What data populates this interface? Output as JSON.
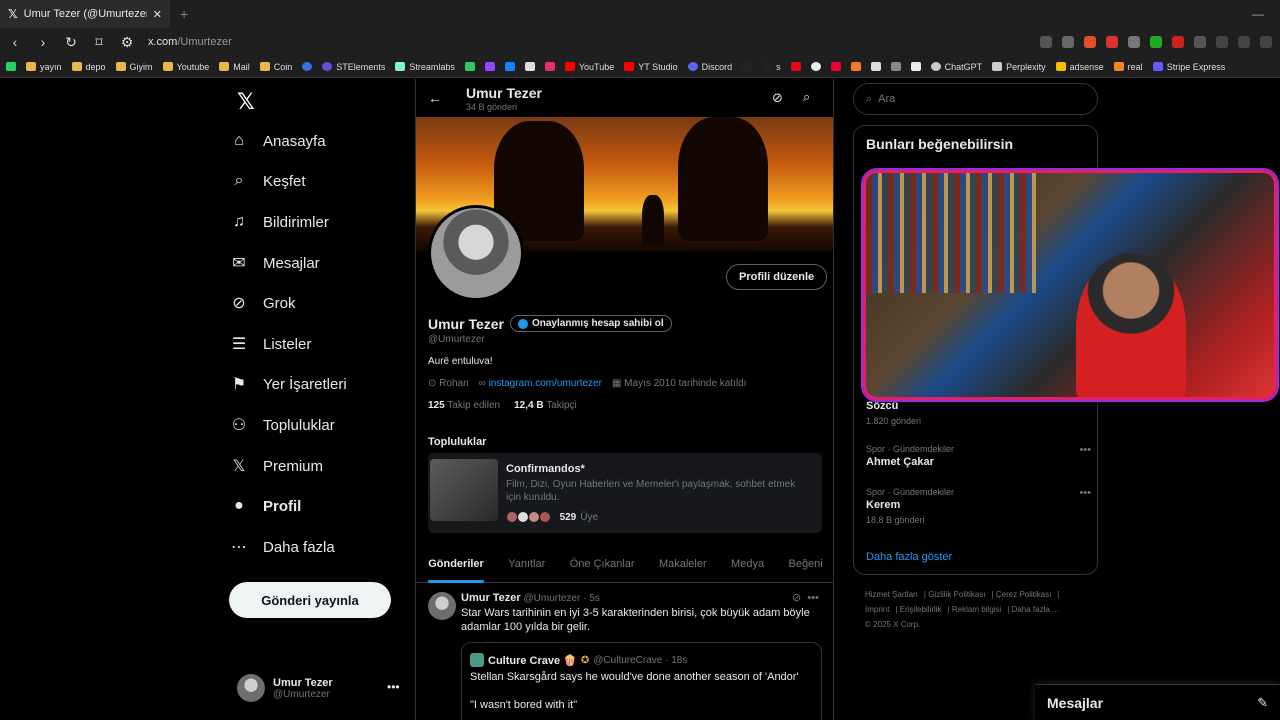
{
  "browser": {
    "tab_title": "Umur Tezer (@Umurtezer) / X",
    "url_host": "x.com",
    "url_path": "/Umurtezer",
    "bookmarks": [
      "yayın",
      "depo",
      "Giyim",
      "Youtube",
      "Mail",
      "Coin",
      "STElements",
      "Streamlabs",
      "YouTube",
      "YT Studio",
      "Discord",
      "s",
      "ChatGPT",
      "Perplexity",
      "adsense",
      "real",
      "Stripe Express"
    ]
  },
  "nav": {
    "items": [
      "Anasayfa",
      "Keşfet",
      "Bildirimler",
      "Mesajlar",
      "Grok",
      "Listeler",
      "Yer İşaretleri",
      "Topluluklar",
      "Premium",
      "Profil",
      "Daha fazla"
    ],
    "post_button": "Gönderi yayınla",
    "me_name": "Umur Tezer",
    "me_handle": "@Umurtezer"
  },
  "profile": {
    "header_name": "Umur Tezer",
    "header_posts": "34 B gönderi",
    "edit_button": "Profili düzenle",
    "name": "Umur Tezer",
    "verified_label": "Onaylanmış hesap sahibi ol",
    "handle": "@Umurtezer",
    "bio": "Aurë entuluva!",
    "location": "Rohan",
    "link": "instagram.com/umurtezer",
    "joined": "Mayıs 2010 tarihinde katıldı",
    "following_count": "125",
    "following_label": "Takip edilen",
    "followers_count": "12,4 B",
    "followers_label": "Takipçi"
  },
  "communities": {
    "heading": "Topluluklar",
    "name": "Confirmandos*",
    "desc": "Film, Dizi, Oyun Haberleri ve Memeler'i paylaşmak, sohbet etmek için kuruldu.",
    "members_count": "529",
    "members_label": "Üye"
  },
  "tabs": [
    "Gönderiler",
    "Yanıtlar",
    "Öne Çıkanlar",
    "Makaleler",
    "Medya",
    "Beğeni"
  ],
  "tweet": {
    "name": "Umur Tezer",
    "handle_time": "@Umurtezer · 5s",
    "text": "Star Wars tarihinin en iyi 3-5 karakterinden birisi, çok büyük adam böyle adamlar 100 yılda bir gelir.",
    "quote_name": "Culture Crave 🍿",
    "quote_handle_time": "@CultureCrave · 18s",
    "quote_line1": "Stellan Skarsgård says he would've done another season of 'Andor'",
    "quote_line2": "\"I wasn't bored with it\""
  },
  "right": {
    "search_placeholder": "Ara",
    "wtf_heading": "Bunları beğenebilirsin",
    "trends": [
      {
        "category": "",
        "name": "Sözcü",
        "posts": "1.820 gönderi"
      },
      {
        "category": "Spor · Gündemdekiler",
        "name": "Ahmet Çakar",
        "posts": ""
      },
      {
        "category": "Spor · Gündemdekiler",
        "name": "Kerem",
        "posts": "18,8 B gönderi"
      }
    ],
    "show_more": "Daha fazla göster",
    "footer": [
      "Hizmet Şartları",
      "Gizlilik Politikası",
      "Çerez Politikası",
      "Imprint",
      "Erişilebilirlik",
      "Reklam bilgisi",
      "Daha fazla ...",
      "© 2025 X Corp."
    ]
  },
  "messages_drawer": "Mesajlar",
  "colors": {
    "accent": "#1d9bf0",
    "bg": "#000000",
    "border": "#2f3336"
  }
}
